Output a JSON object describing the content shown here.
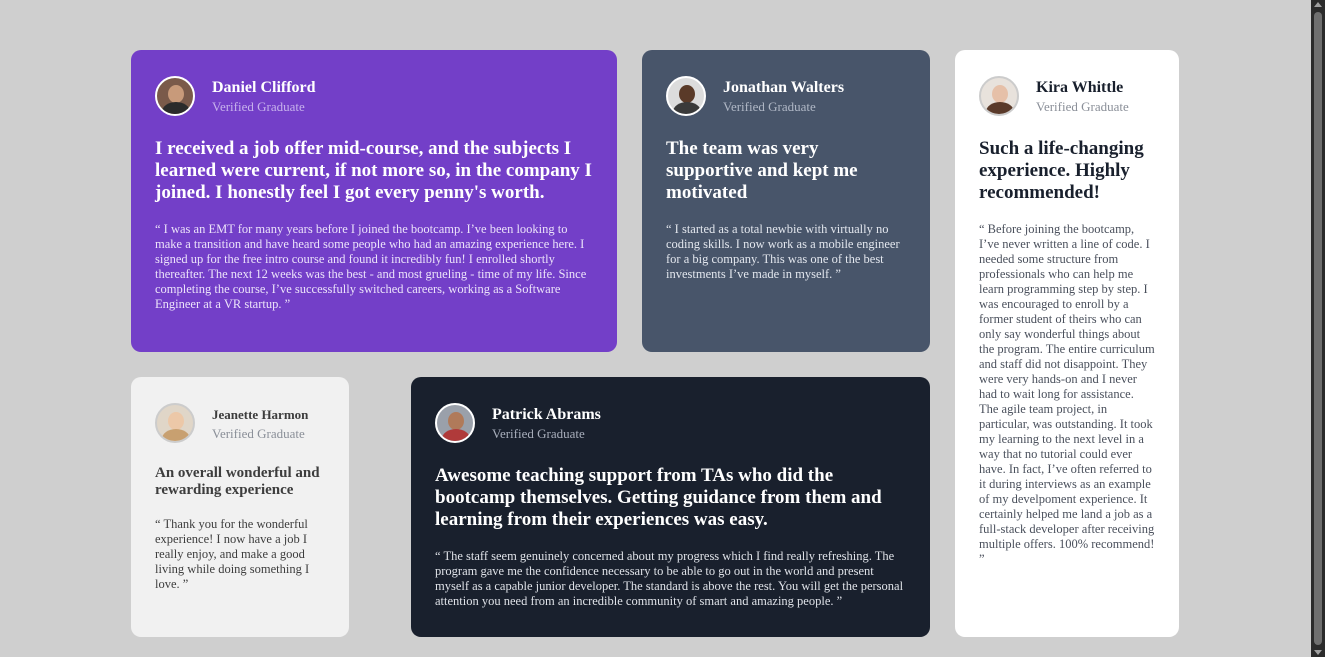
{
  "testimonials": [
    {
      "name": "Daniel Clifford",
      "role": "Verified Graduate",
      "headline": "I received a job offer mid-course, and the subjects I learned were current, if not more so, in the company I joined. I honestly feel I got every penny's worth.",
      "quote": "“ I was an EMT for many years before I joined the bootcamp. I’ve been looking to make a transition and have heard some people who had an amazing experience here. I signed up for the free intro course and found it incredibly fun! I enrolled shortly thereafter. The next 12 weeks was the best - and most grueling - time of my life. Since completing the course, I’ve successfully switched careers, working as a Software Engineer at a VR startup. ”",
      "avatar_icon": "avatar-daniel-icon"
    },
    {
      "name": "Jonathan Walters",
      "role": "Verified Graduate",
      "headline": "The team was very supportive and kept me motivated",
      "quote": "“ I started as a total newbie with virtually no coding skills. I now work as a mobile engineer for a big company. This was one of the best investments I’ve made in myself. ”",
      "avatar_icon": "avatar-jonathan-icon"
    },
    {
      "name": "Kira Whittle",
      "role": "Verified Graduate",
      "headline": "Such a life-changing experience. Highly recommended!",
      "quote": "“ Before joining the bootcamp, I’ve never written a line of code. I needed some structure from professionals who can help me learn programming step by step. I was encouraged to enroll by a former student of theirs who can only say wonderful things about the program. The entire curriculum and staff did not disappoint. They were very hands-on and I never had to wait long for assistance. The agile team project, in particular, was outstanding. It took my learning to the next level in a way that no tutorial could ever have. In fact, I’ve often referred to it during interviews as an example of my develpoment experience. It certainly helped me land a job as a full-stack developer after receiving multiple offers. 100% recommend! ”",
      "avatar_icon": "avatar-kira-icon"
    },
    {
      "name": "Jeanette Harmon",
      "role": "Verified Graduate",
      "headline": "An overall wonderful and rewarding experience",
      "quote": "“ Thank you for the wonderful experience! I now have a job I really enjoy, and make a good living while doing something I love. ”",
      "avatar_icon": "avatar-jeanette-icon"
    },
    {
      "name": "Patrick Abrams",
      "role": "Verified Graduate",
      "headline": "Awesome teaching support from TAs who did the bootcamp themselves. Getting guidance from them and learning from their experiences was easy.",
      "quote": "“ The staff seem genuinely concerned about my progress which I find really refreshing. The program gave me the confidence necessary to be able to go out in the world and present myself as a capable junior developer. The standard is above the rest. You will get the personal attention you need from an incredible community of smart and amazing people. ”",
      "avatar_icon": "avatar-patrick-icon"
    }
  ],
  "colors": {
    "background": "#cfcfcf",
    "purple_card": "#733fc8",
    "slate_card": "#48556a",
    "white_card": "#ffffff",
    "light_card": "#f1f1f1",
    "dark_card": "#19202d"
  }
}
